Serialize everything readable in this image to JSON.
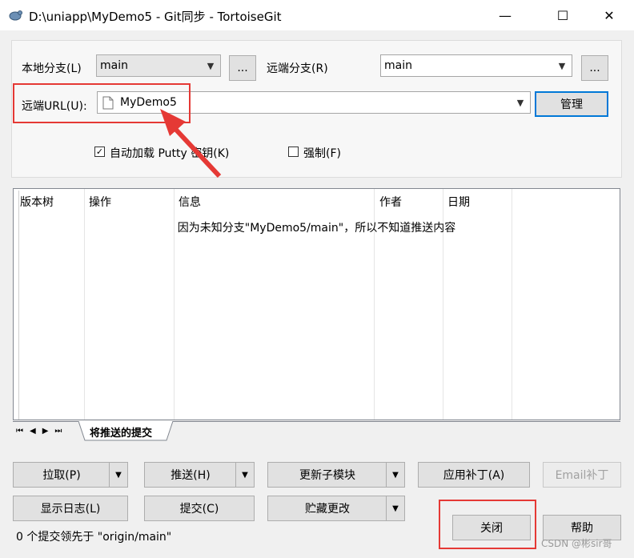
{
  "window": {
    "title": "D:\\uniapp\\MyDemo5 - Git同步 - TortoiseGit",
    "minimize_glyph": "—",
    "maximize_glyph": "☐",
    "close_glyph": "✕"
  },
  "local_branch": {
    "label": "本地分支(L)",
    "value": "main",
    "browse": "..."
  },
  "remote_branch": {
    "label": "远端分支(R)",
    "value": "main",
    "browse": "..."
  },
  "remote_url": {
    "label": "远端URL(U):",
    "value": "MyDemo5",
    "manage_label": "管理"
  },
  "options": {
    "autoload_putty": {
      "label": "自动加载 Putty 密钥(K)",
      "checked": true
    },
    "force": {
      "label": "强制(F)",
      "checked": false
    }
  },
  "list": {
    "columns": [
      "版本树",
      "操作",
      "信息",
      "作者",
      "日期"
    ],
    "message": "因为未知分支\"MyDemo5/main\"，所以不知道推送内容"
  },
  "tab": {
    "label": "将推送的提交"
  },
  "buttons": {
    "pull": "拉取(P)",
    "push": "推送(H)",
    "update_submodules": "更新子模块",
    "apply_patch": "应用补丁(A)",
    "email_patch": "Email补丁",
    "show_log": "显示日志(L)",
    "commit": "提交(C)",
    "stash": "贮藏更改",
    "close": "关闭",
    "help": "帮助"
  },
  "status": "0 个提交领先于 \"origin/main\"",
  "watermark": "CSDN @彬sir哥",
  "colors": {
    "annotation_red": "#e53935",
    "focus_blue": "#0078d7"
  }
}
